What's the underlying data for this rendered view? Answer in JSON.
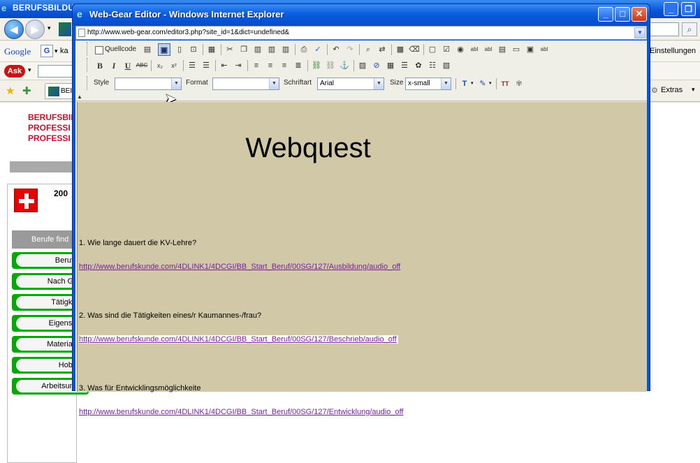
{
  "background_window": {
    "title": "BERUFSBILDU",
    "google_label": "Google",
    "google_field": "ka",
    "settings_label": "Einstellungen",
    "extras_label": "Extras",
    "fav_tab": "BEI",
    "logo_lines": [
      "BERUFSBIL",
      "PROFESSI",
      "PROFESSI"
    ],
    "year": "200",
    "sidebar_header": "Berufe find",
    "sidebar_items": [
      "Berufe A",
      "Nach Grup",
      "Tätigkeite",
      "Eigenscha",
      "Materialien",
      "Hobbys",
      "Arbeitsumge"
    ]
  },
  "popup": {
    "title": "Web-Gear Editor - Windows Internet Explorer",
    "url": "http://www.web-gear.com/editor3.php?site_id=1&dict=undefined&",
    "toolbar": {
      "source_label": "Quellcode",
      "style_label": "Style",
      "style_value": "",
      "format_label": "Format",
      "format_value": "",
      "font_label": "Schriftart",
      "font_value": "Arial",
      "size_label": "Size",
      "size_value": "x-small"
    },
    "document": {
      "heading": "Webquest",
      "questions": [
        {
          "text": "1. Wie lange dauert die KV-Lehre?",
          "link": "http://www.berufskunde.com/4DLINK1/4DCGI/BB_Start_Beruf/00SG/127/Ausbildung/audio_off"
        },
        {
          "text": "2. Was sind die Tätigkeiten eines/r Kaumannes-/frau?",
          "link": "http://www.berufskunde.com/4DLINK1/4DCGI/BB_Start_Beruf/00SG/127/Beschrieb/audio_off"
        },
        {
          "text": "3. Was für Entwicklingsmöglichkeite",
          "link": "http://www.berufskunde.com/4DLINK1/4DCGI/BB_Start_Beruf/00SG/127/Entwicklung/audio_off"
        }
      ]
    }
  },
  "colors": {
    "titlebar_blue": "#0a58d8",
    "editor_bg": "#d0c8a6",
    "link_purple": "#7a1fa2",
    "sidebar_green": "#00aa00"
  }
}
